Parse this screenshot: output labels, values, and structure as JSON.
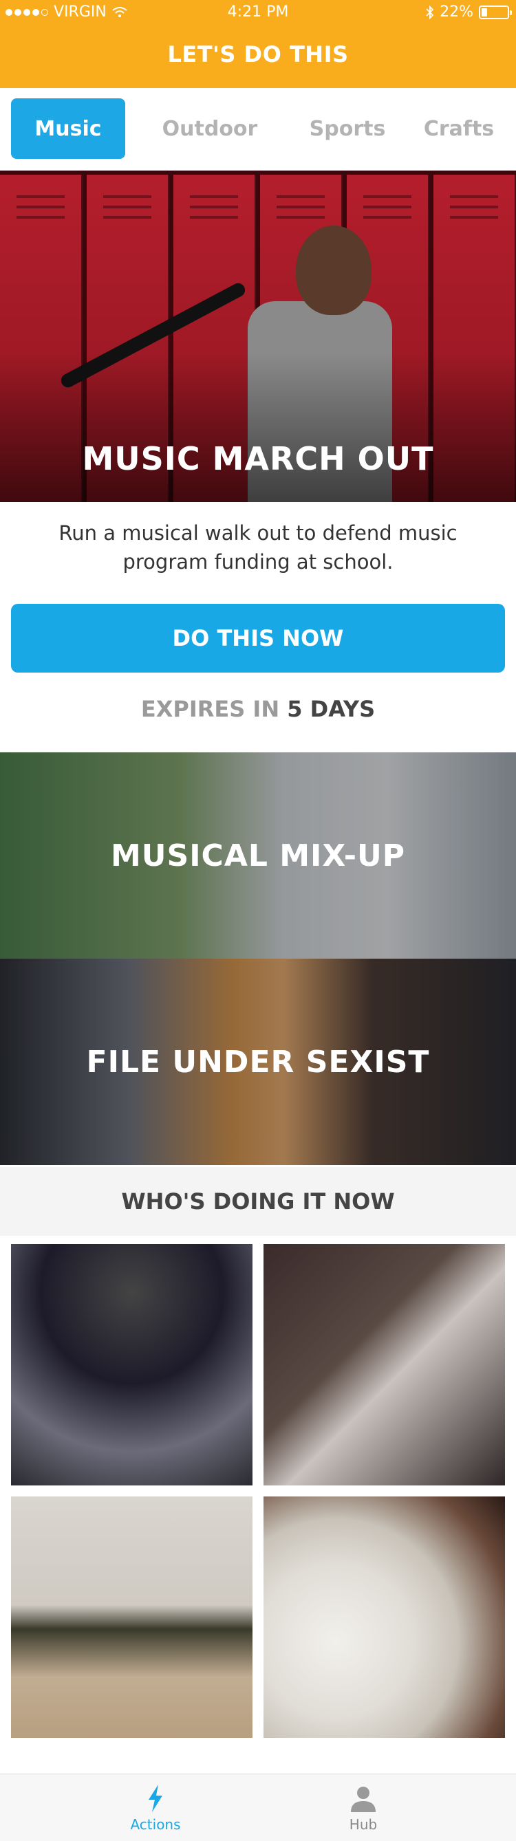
{
  "status": {
    "carrier": "VIRGIN",
    "time": "4:21 PM",
    "battery": "22%"
  },
  "header": {
    "title": "LET'S DO THIS"
  },
  "tabs": [
    {
      "label": "Music",
      "active": true
    },
    {
      "label": "Outdoor",
      "active": false
    },
    {
      "label": "Sports",
      "active": false
    },
    {
      "label": "Crafts",
      "active": false
    }
  ],
  "hero": {
    "title": "MUSIC MARCH OUT",
    "description": "Run a musical walk out to defend music program funding at school.",
    "cta_label": "DO THIS NOW",
    "expires_prefix": "EXPIRES IN",
    "expires_value": "5 DAYS"
  },
  "cards": [
    {
      "title": "MUSICAL MIX-UP"
    },
    {
      "title": "FILE UNDER SEXIST"
    }
  ],
  "who": {
    "title": "WHO'S DOING IT NOW"
  },
  "nav": {
    "items": [
      {
        "label": "Actions",
        "icon": "lightning-icon",
        "active": true
      },
      {
        "label": "Hub",
        "icon": "person-icon",
        "active": false
      }
    ]
  },
  "colors": {
    "header": "#f9ad1c",
    "accent": "#19a8e6"
  }
}
